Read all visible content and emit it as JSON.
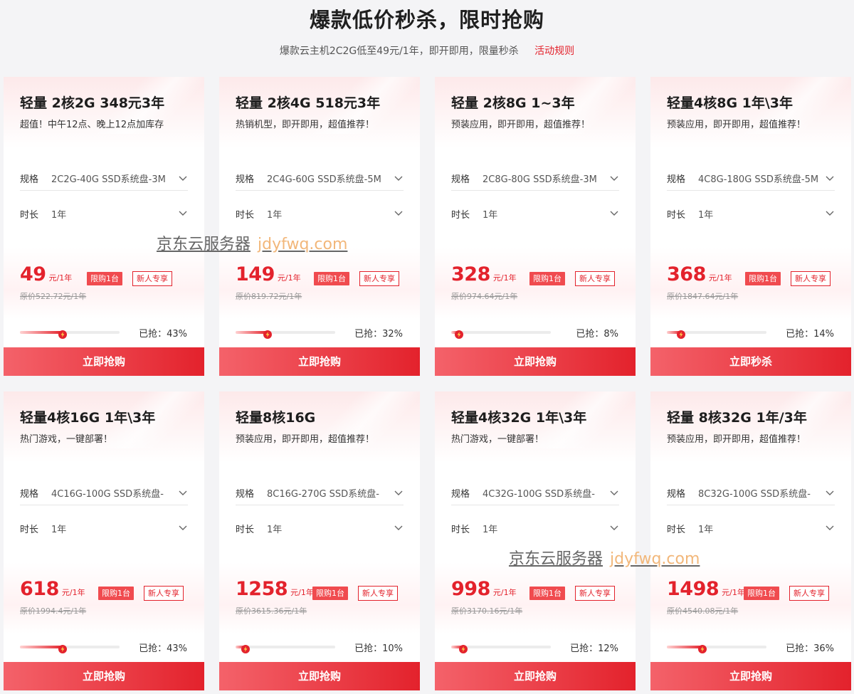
{
  "header": {
    "title": "爆款低价秒杀，限时抢购",
    "subtitle": "爆款云主机2C2G低至49元/1年，即开即用，限量秒杀",
    "rules_link": "活动规则"
  },
  "labels": {
    "spec": "规格",
    "duration": "时长",
    "unit": "元/1年",
    "limit_badge": "限购1台",
    "new_badge": "新人专享",
    "sold_prefix": "已抢："
  },
  "watermark": {
    "cn": "京东云服务器",
    "url": "jdyfwq.com"
  },
  "accent_color": "#e3222c",
  "cards": [
    {
      "title": "轻量 2核2G 348元3年",
      "desc": "超值！中午12点、晚上12点加库存",
      "spec": "2C2G-40G SSD系统盘-3M",
      "duration": "1年",
      "price": "49",
      "orig": "原价522.72元/1年",
      "sold": "43%",
      "progress": 0.43,
      "button": "立即抢购"
    },
    {
      "title": "轻量 2核4G 518元3年",
      "desc": "热销机型，即开即用，超值推荐！",
      "spec": "2C4G-60G SSD系统盘-5M",
      "duration": "1年",
      "price": "149",
      "orig": "原价819.72元/1年",
      "sold": "32%",
      "progress": 0.32,
      "button": "立即抢购"
    },
    {
      "title": "轻量 2核8G 1~3年",
      "desc": "预装应用，即开即用，超值推荐！",
      "spec": "2C8G-80G SSD系统盘-3M",
      "duration": "1年",
      "price": "328",
      "orig": "原价974.64元/1年",
      "sold": "8%",
      "progress": 0.08,
      "button": "立即抢购"
    },
    {
      "title": "轻量4核8G 1年\\3年",
      "desc": "预装应用，即开即用，超值推荐！",
      "spec": "4C8G-180G SSD系统盘-5M",
      "duration": "1年",
      "price": "368",
      "orig": "原价1847.64元/1年",
      "sold": "14%",
      "progress": 0.14,
      "button": "立即秒杀"
    },
    {
      "title": "轻量4核16G 1年\\3年",
      "desc": "热门游戏，一键部署！",
      "spec": "4C16G-100G SSD系统盘-",
      "duration": "1年",
      "price": "618",
      "orig": "原价1994.4元/1年",
      "sold": "43%",
      "progress": 0.43,
      "button": "立即抢购"
    },
    {
      "title": "轻量8核16G",
      "desc": "预装应用，即开即用，超值推荐！",
      "spec": "8C16G-270G SSD系统盘-",
      "duration": "1年",
      "price": "1258",
      "orig": "原价3615.36元/1年",
      "sold": "10%",
      "progress": 0.1,
      "button": "立即抢购"
    },
    {
      "title": "轻量4核32G 1年\\3年",
      "desc": "热门游戏，一键部署！",
      "spec": "4C32G-100G SSD系统盘-",
      "duration": "1年",
      "price": "998",
      "orig": "原价3170.16元/1年",
      "sold": "12%",
      "progress": 0.12,
      "button": "立即抢购"
    },
    {
      "title": "轻量 8核32G 1年/3年",
      "desc": "预装应用，即开即用，超值推荐！",
      "spec": "8C32G-100G SSD系统盘-",
      "duration": "1年",
      "price": "1498",
      "orig": "原价4540.08元/1年",
      "sold": "36%",
      "progress": 0.36,
      "button": "立即抢购"
    }
  ]
}
